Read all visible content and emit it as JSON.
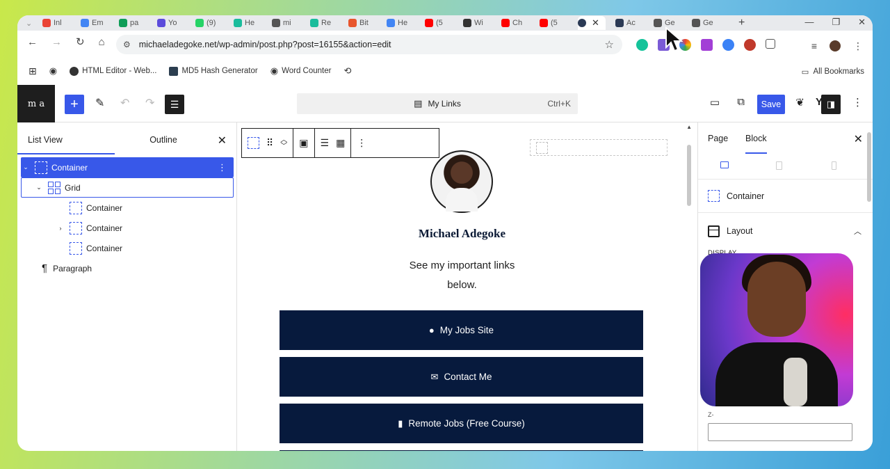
{
  "browser": {
    "tabs": [
      {
        "label": "Inl",
        "color": "#ea4335"
      },
      {
        "label": "Em",
        "color": "#4285f4"
      },
      {
        "label": "pa",
        "color": "#0f9d58"
      },
      {
        "label": "Yo",
        "color": "#5b4bdb"
      },
      {
        "label": "(9)",
        "color": "#25d366"
      },
      {
        "label": "He",
        "color": "#1abc9c"
      },
      {
        "label": "mi",
        "color": "#555555"
      },
      {
        "label": "Re",
        "color": "#1abc9c"
      },
      {
        "label": "Bit",
        "color": "#e8552d"
      },
      {
        "label": "He",
        "color": "#4285f4"
      },
      {
        "label": "(5",
        "color": "#ff0000"
      },
      {
        "label": "Wi",
        "color": "#333333"
      },
      {
        "label": "Ch",
        "color": "#ff0000"
      },
      {
        "label": "(5",
        "color": "#ff0000"
      }
    ],
    "tabs_after": [
      {
        "label": "Ac",
        "color": "#2b3a55"
      },
      {
        "label": "Ge",
        "color": "#555555"
      },
      {
        "label": "Ge",
        "color": "#555555"
      }
    ],
    "url": "michaeladegoke.net/wp-admin/post.php?post=16155&action=edit",
    "bookmarks": [
      {
        "label": "HTML Editor - Web..."
      },
      {
        "label": "MD5 Hash Generator"
      },
      {
        "label": "Word Counter"
      }
    ],
    "all_bookmarks": "All Bookmarks"
  },
  "wp": {
    "logo": "m a",
    "command_bar": "My Links",
    "shortcut": "Ctrl+K",
    "save": "Save"
  },
  "listview": {
    "tab_list": "List View",
    "tab_outline": "Outline",
    "rows": {
      "container": "Container",
      "grid": "Grid",
      "child1": "Container",
      "child2": "Container",
      "child3": "Container",
      "paragraph": "Paragraph"
    }
  },
  "canvas": {
    "name": "Michael Adegoke",
    "tagline": "See my important links below.",
    "buttons": [
      {
        "label": "My Jobs Site",
        "icon": "user-circle-icon"
      },
      {
        "label": "Contact Me",
        "icon": "envelope-icon"
      },
      {
        "label": "Remote Jobs (Free Course)",
        "icon": "book-icon"
      }
    ]
  },
  "sidebar": {
    "tab_page": "Page",
    "tab_block": "Block",
    "block_name": "Container",
    "panel_layout": "Layout",
    "display_label": "DISPLAY",
    "z_label": "Z-"
  }
}
